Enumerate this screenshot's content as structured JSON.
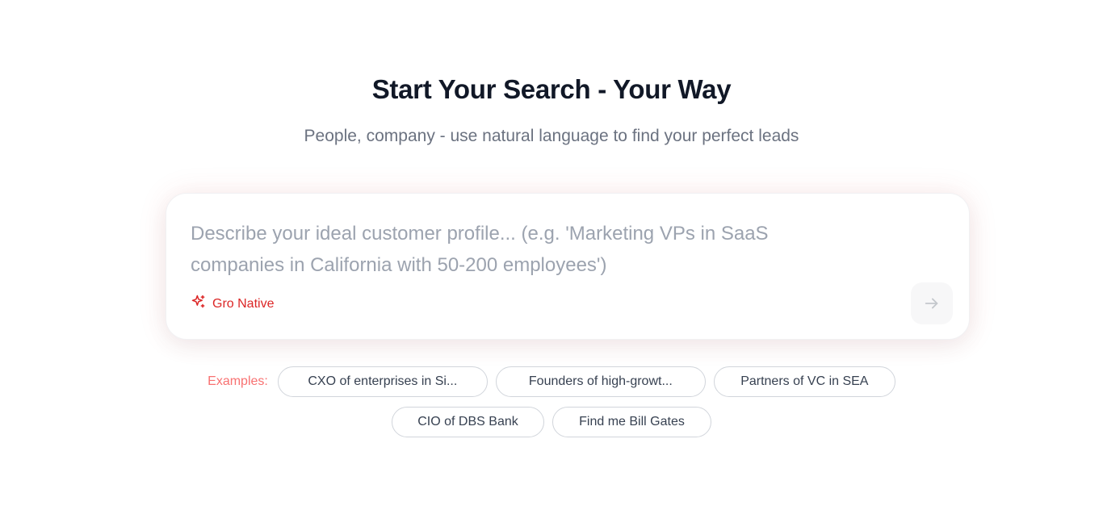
{
  "header": {
    "title": "Start Your Search - Your Way",
    "subtitle": "People, company - use natural language to find your perfect leads"
  },
  "search": {
    "value": "",
    "placeholder": "Describe your ideal customer profile... (e.g. 'Marketing VPs in SaaS companies in California with 50-200 employees')",
    "mode_label": "Gro Native",
    "mode_icon": "sparkle-icon",
    "submit_icon": "arrow-right-icon"
  },
  "examples": {
    "label": "Examples:",
    "items": [
      "CXO of enterprises in Si...",
      "Founders of high-growt...",
      "Partners of VC in SEA",
      "CIO of DBS Bank",
      "Find me Bill Gates"
    ]
  },
  "colors": {
    "accent": "#dc2626",
    "examples_label": "#f87171",
    "title": "#111827",
    "subtitle": "#6b7280"
  }
}
